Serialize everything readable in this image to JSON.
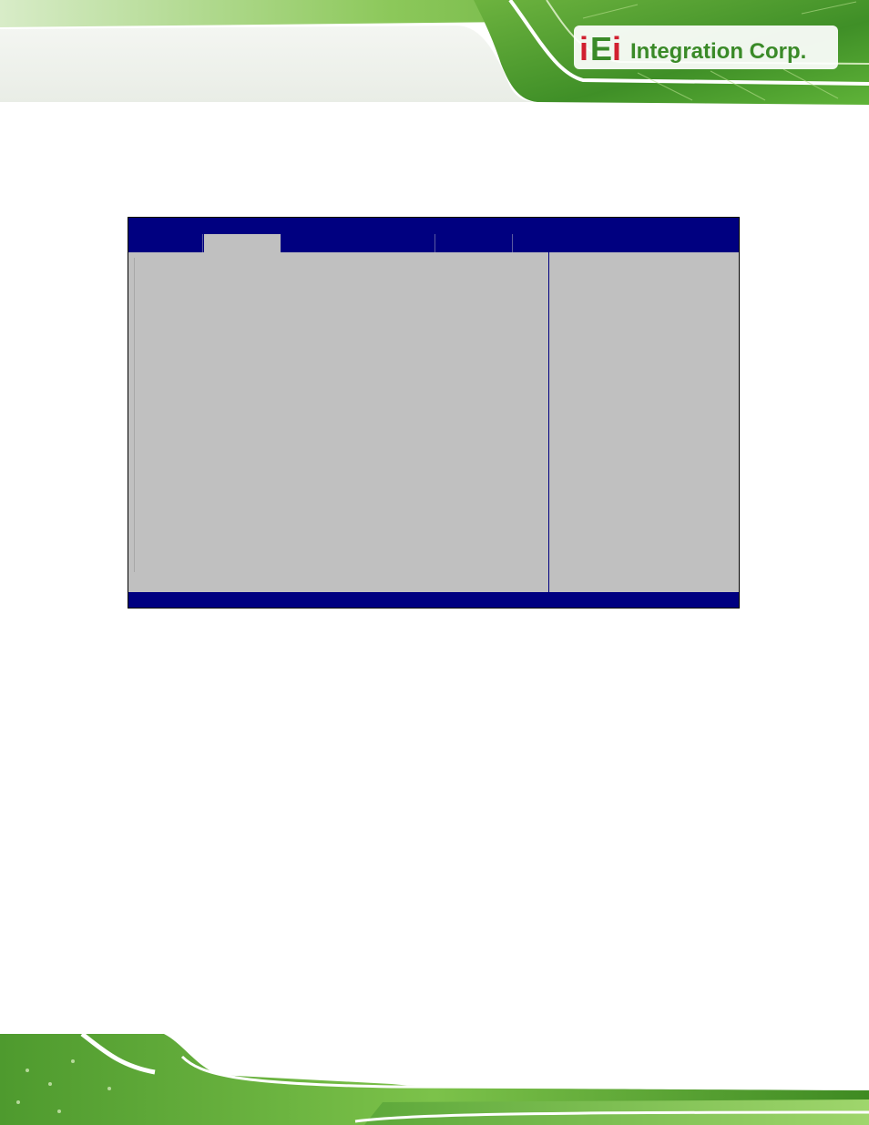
{
  "brand": {
    "logo_text": "iEi Integration Corp."
  },
  "colors": {
    "bios_blue": "#000080",
    "bios_gray": "#c0c0c0",
    "brand_green": "#7dc242",
    "brand_red": "#d11f2f"
  },
  "bios": {
    "tabs": [
      {
        "label": "",
        "active": false
      },
      {
        "label": "",
        "active": true
      },
      {
        "label": "",
        "active": false
      },
      {
        "label": "",
        "active": false
      },
      {
        "label": "",
        "active": false
      }
    ],
    "status_bar": ""
  }
}
